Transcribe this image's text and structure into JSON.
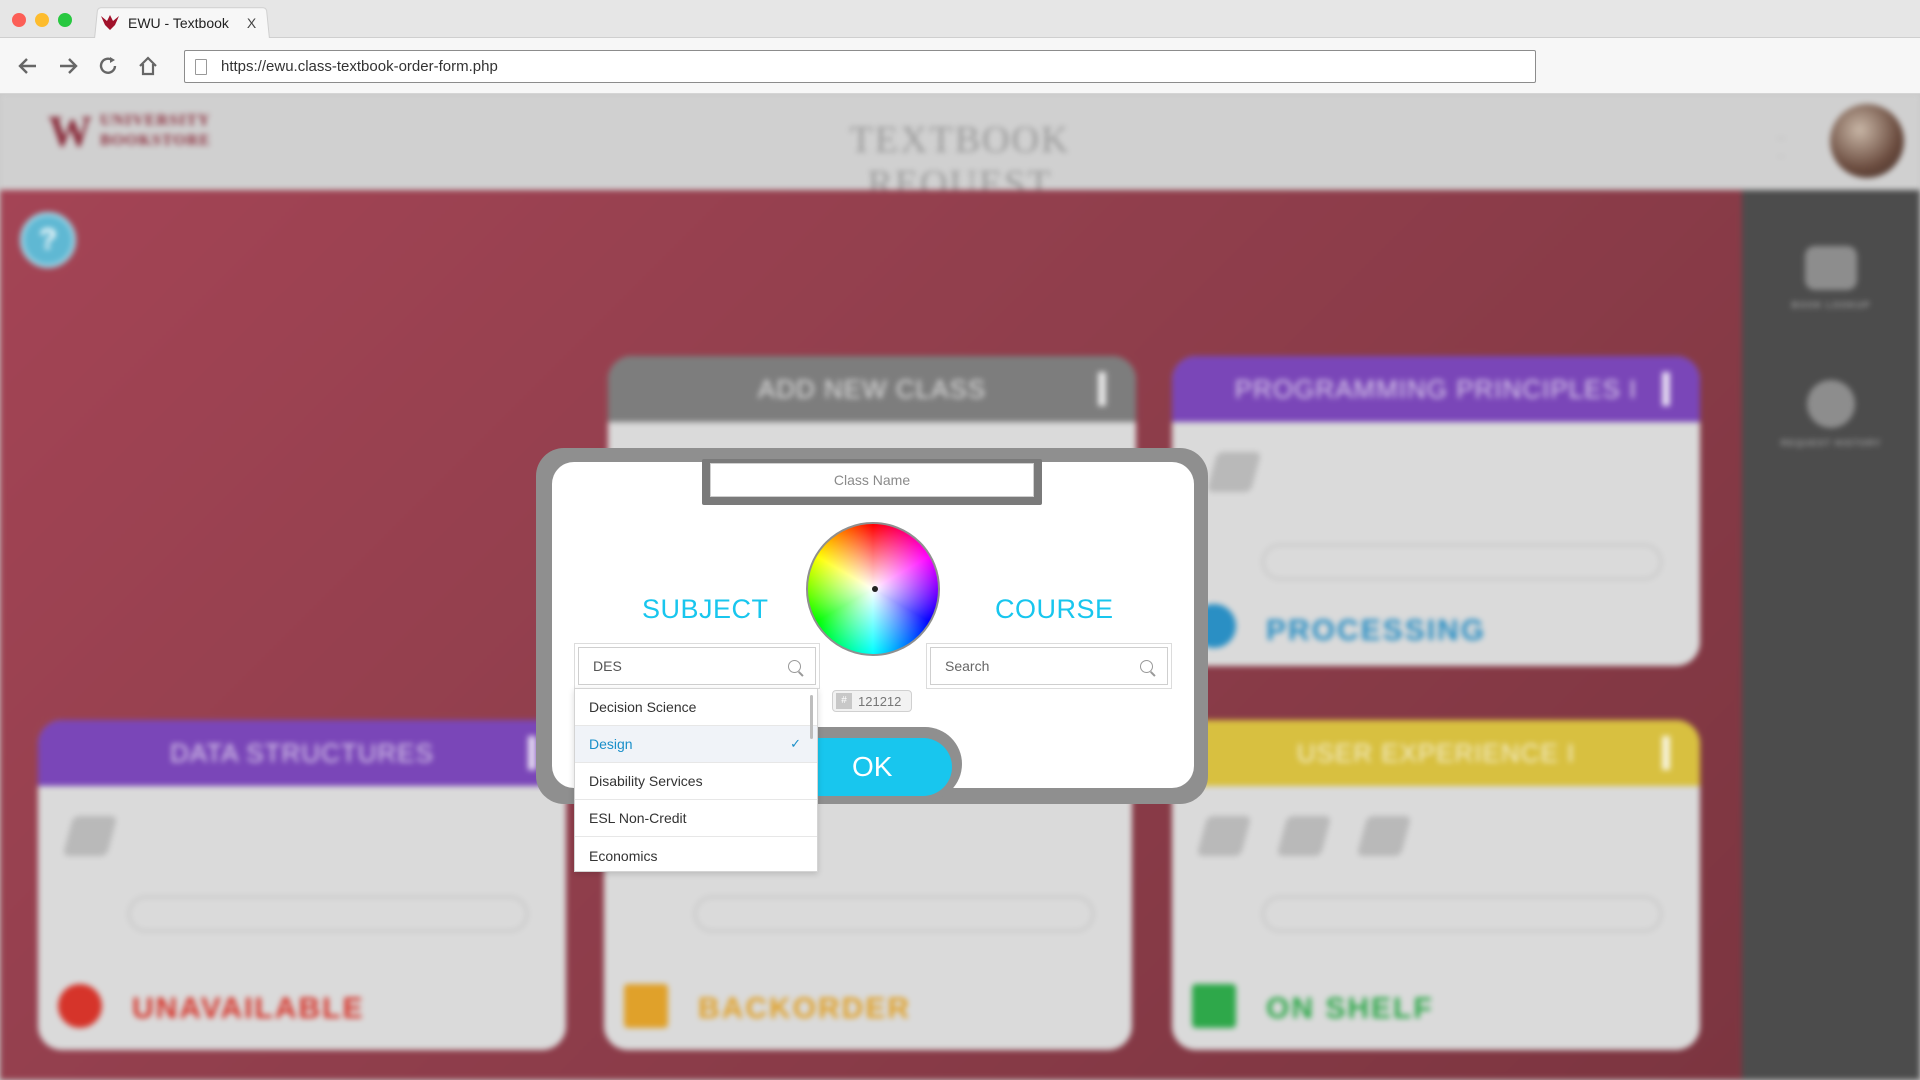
{
  "browser": {
    "tab_title": "EWU - Textbook",
    "tab_close": "X",
    "url": "https://ewu.class-textbook-order-form.php",
    "buttons": {
      "back": "back-arrow-icon",
      "forward": "forward-arrow-icon",
      "reload": "reload-icon",
      "home": "home-icon"
    }
  },
  "app": {
    "header_title": "TEXTBOOK REQUEST",
    "logo": {
      "line1": "UNIVERSITY",
      "line2": "BOOKSTORE"
    },
    "sidebar": [
      {
        "label": "BOOK LOOKUP",
        "icon": "book-stack-icon"
      },
      {
        "label": "REQUEST HISTORY",
        "icon": "history-icon"
      }
    ],
    "cards": [
      {
        "title": "ADD NEW CLASS",
        "color": "#7a7a7a"
      },
      {
        "title": "PROGRAMMING PRINCIPLES I",
        "color": "#7a46b8",
        "status": "PROCESSING",
        "status_color": "#2a8fc4"
      },
      {
        "title": "DATA STRUCTURES",
        "color": "#7a46b8",
        "status": "UNAVAILABLE",
        "status_color": "#d6342a"
      },
      {
        "title": "",
        "color": "#7a7a7a",
        "status": "BACKORDER",
        "status_color": "#e0a12a"
      },
      {
        "title": "USER EXPERIENCE I",
        "color": "#d8c040",
        "status": "ON SHELF",
        "status_color": "#2ea84a"
      }
    ]
  },
  "modal": {
    "class_name_placeholder": "Class Name",
    "subject_title": "SUBJECT",
    "course_title": "COURSE",
    "subject_search_value": "DES",
    "course_search_placeholder": "Search",
    "hex_prefix": "#",
    "hex_value": "121212",
    "ok_label": "OK",
    "accent_color": "#18c6ee",
    "dropdown_items": [
      {
        "label": "Decision Science",
        "selected": false
      },
      {
        "label": "Design",
        "selected": true,
        "check": "✓"
      },
      {
        "label": "Disability Services",
        "selected": false
      },
      {
        "label": "ESL Non-Credit",
        "selected": false
      },
      {
        "label": "Economics",
        "selected": false
      }
    ]
  }
}
